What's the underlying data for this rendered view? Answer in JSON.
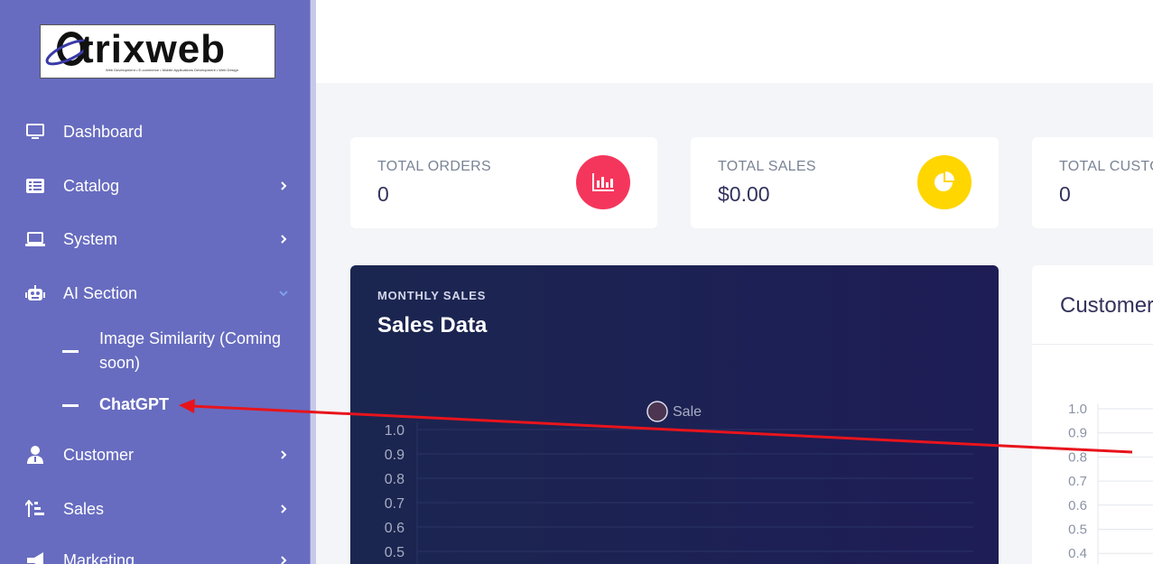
{
  "logo": {
    "text": "trixweb",
    "lead_letter": "O",
    "tagline": "Web Development • E-commerce • Mobile Applications Development • Web Design"
  },
  "sidebar": {
    "items": [
      {
        "label": "Dashboard",
        "icon": "monitor-icon"
      },
      {
        "label": "Catalog",
        "icon": "list-icon"
      },
      {
        "label": "System",
        "icon": "laptop-icon"
      },
      {
        "label": "AI Section",
        "icon": "robot-icon"
      },
      {
        "label": "Customer",
        "icon": "user-icon"
      },
      {
        "label": "Sales",
        "icon": "sort-amount-icon"
      },
      {
        "label": "Marketing",
        "icon": "megaphone-icon"
      }
    ],
    "sub_items": [
      {
        "label": "Image Similarity (Coming soon)"
      },
      {
        "label": "ChatGPT"
      }
    ]
  },
  "cards": [
    {
      "title": "TOTAL ORDERS",
      "value": "0",
      "icon": "chart-bar-icon",
      "color": "#f5365c"
    },
    {
      "title": "TOTAL SALES",
      "value": "$0.00",
      "icon": "chart-pie-icon",
      "color": "#ffd600"
    },
    {
      "title": "TOTAL CUSTOMERS",
      "value": "0",
      "icon": "users-icon",
      "color": "#fb6340"
    }
  ],
  "sales_chart": {
    "overline": "MONTHLY SALES",
    "title": "Sales Data",
    "legend": "Sale"
  },
  "customer_panel": {
    "title": "Customers"
  },
  "chart_data": [
    {
      "type": "line",
      "title": "Sales Data",
      "series": [
        {
          "name": "Sale",
          "values": []
        }
      ],
      "y_ticks": [
        "1.0",
        "0.9",
        "0.8",
        "0.7",
        "0.6",
        "0.5"
      ],
      "ylim": [
        0,
        1.0
      ],
      "grid": true,
      "legend": "top"
    },
    {
      "type": "line",
      "title": "Customers",
      "series": [],
      "y_ticks": [
        "1.0",
        "0.9",
        "0.8",
        "0.7",
        "0.6",
        "0.5",
        "0.4"
      ],
      "ylim": [
        0,
        1.0
      ],
      "grid": true
    }
  ],
  "colors": {
    "sidebar": "#676cc0",
    "chart_bg": "#1b2650",
    "annotation_arrow": "#e8141c"
  }
}
